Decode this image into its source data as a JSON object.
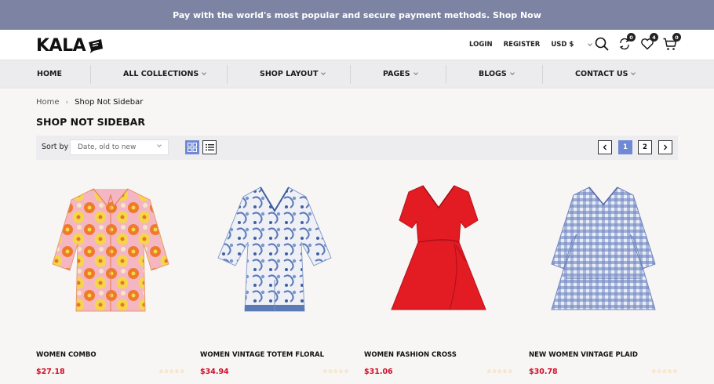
{
  "promo": {
    "text": "Pay with the world's most popular and secure payment methods. Shop Now"
  },
  "header": {
    "logo_text": "KALA",
    "account": {
      "login": "LOGIN",
      "register": "REGISTER",
      "currency": "USD $"
    },
    "icons": [
      {
        "name": "search-icon"
      },
      {
        "name": "compare-icon",
        "count": "0"
      },
      {
        "name": "wishlist-icon",
        "count": "4"
      },
      {
        "name": "cart-icon",
        "count": "0"
      }
    ]
  },
  "nav": [
    "HOME",
    "ALL COLLECTIONS",
    "SHOP LAYOUT",
    "PAGES",
    "BLOGS",
    "CONTACT US"
  ],
  "breadcrumb": {
    "home": "Home",
    "current": "Shop Not Sidebar"
  },
  "page_title": "SHOP NOT SIDEBAR",
  "toolbar": {
    "sort_label": "Sort by",
    "sort_value": "Date, old to new",
    "pages": [
      "1",
      "2"
    ],
    "current_page": "1"
  },
  "products": [
    {
      "name": "WOMEN COMBO",
      "price": "$27.18",
      "rating": 0
    },
    {
      "name": "WOMEN VINTAGE TOTEM FLORAL",
      "price": "$34.94",
      "rating": 0
    },
    {
      "name": "WOMEN FASHION CROSS",
      "price": "$31.06",
      "rating": 0
    },
    {
      "name": "NEW WOMEN VINTAGE PLAID",
      "price": "$30.78",
      "rating": 0
    }
  ],
  "colors": {
    "promo_bg": "#7d84a3",
    "accent": "#6f89d4",
    "price": "#d0102a",
    "stars": "#f0a83a"
  }
}
